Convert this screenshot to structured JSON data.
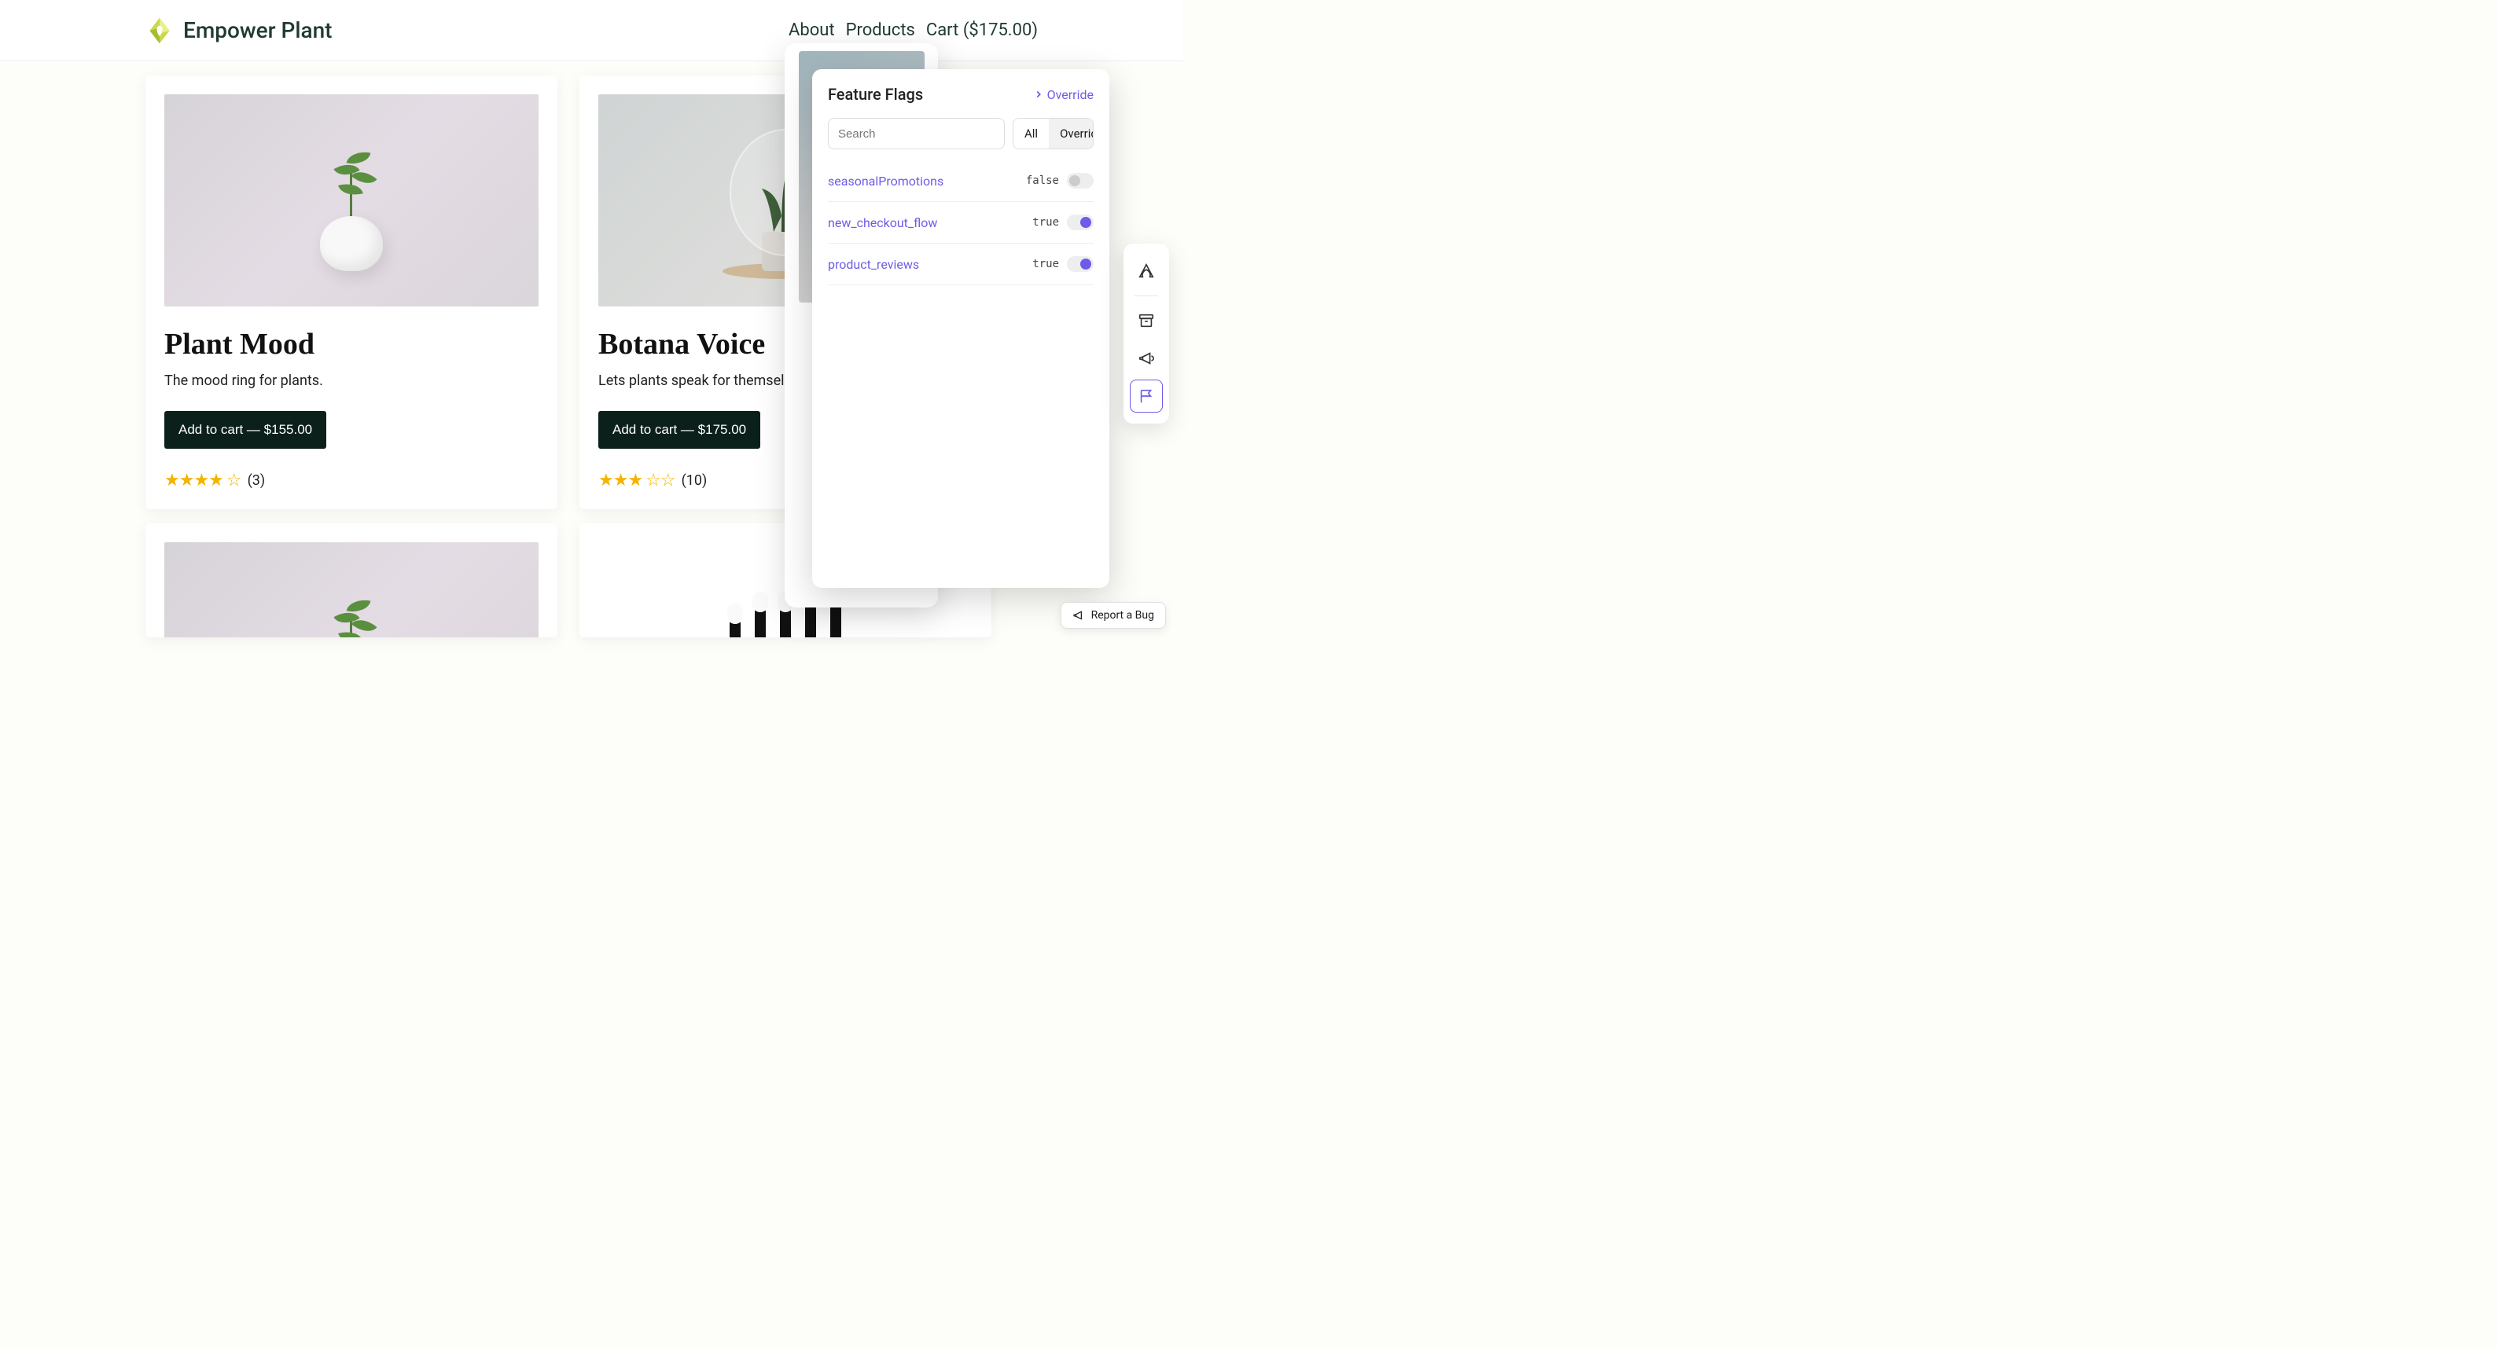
{
  "brand": {
    "name": "Empower Plant"
  },
  "nav": {
    "about": "About",
    "products": "Products",
    "cart": "Cart ($175.00)"
  },
  "products": [
    {
      "title": "Plant Mood",
      "desc": "The mood ring for plants.",
      "cta": "Add to cart — $155.00",
      "rating_filled": "★★★★",
      "rating_empty": "☆",
      "rating_count": "(3)"
    },
    {
      "title": "Botana Voice",
      "desc": "Lets plants speak for themselves.",
      "cta": "Add to cart — $175.00",
      "rating_filled": "★★★",
      "rating_empty": "☆☆",
      "rating_count": "(10)"
    }
  ],
  "feature_flags": {
    "title": "Feature Flags",
    "override_label": "Override",
    "search_placeholder": "Search",
    "tab_all": "All",
    "tab_overrides": "Overrides",
    "flags": [
      {
        "key": "seasonalPromotions",
        "value": "false",
        "on": false
      },
      {
        "key": "new_checkout_flow",
        "value": "true",
        "on": true
      },
      {
        "key": "product_reviews",
        "value": "true",
        "on": true
      }
    ]
  },
  "report_bug": "Report a Bug"
}
